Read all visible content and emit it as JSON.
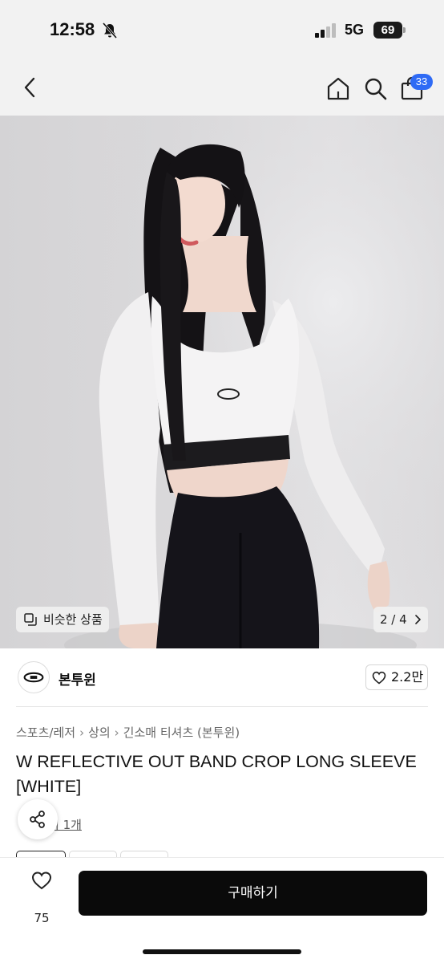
{
  "status_bar": {
    "time": "12:58",
    "network": "5G",
    "battery": "69"
  },
  "nav": {
    "icons": [
      "back-icon",
      "home-icon",
      "search-icon",
      "shopping-bag-icon"
    ],
    "cart_badge": "33"
  },
  "gallery": {
    "similar_label": "비슷한 상품",
    "page_indicator": "2 / 4"
  },
  "seller": {
    "name": "본투윈",
    "likes": "2.2만"
  },
  "product": {
    "breadcrumb": [
      "스포츠/레저",
      "상의",
      "긴소매 티셔츠 (본투윈)"
    ],
    "title": "W REFLECTIVE OUT BAND CROP LONG SLEEVE [WHITE]",
    "review_partial": "기 1개"
  },
  "bottom_bar": {
    "wish_count": "75",
    "buy_label": "구매하기"
  },
  "colors": {
    "accent": "#2f6bf5",
    "buy_button": "#0a0a0a",
    "background": "#ffffff",
    "header_bg": "#f2f2f2"
  }
}
